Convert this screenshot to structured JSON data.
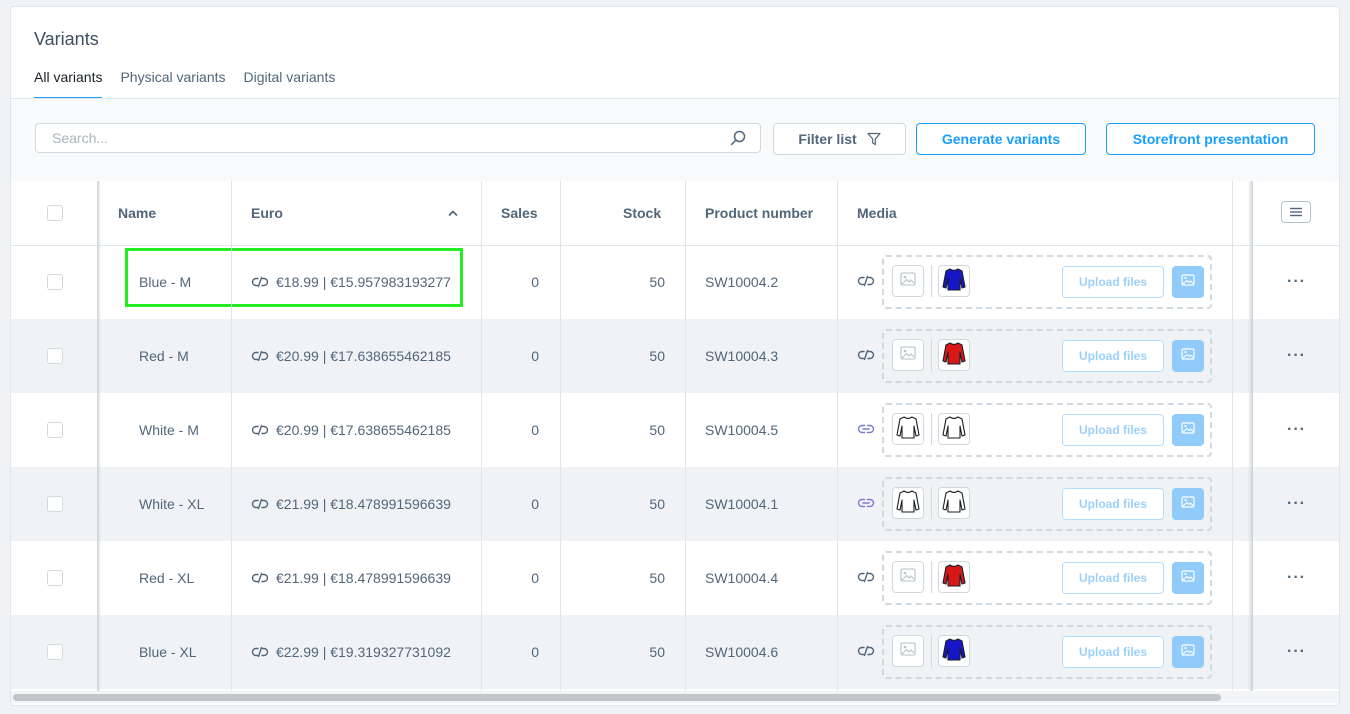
{
  "card": {
    "title": "Variants",
    "tabs": [
      {
        "label": "All variants",
        "active": true
      },
      {
        "label": "Physical variants",
        "active": false
      },
      {
        "label": "Digital variants",
        "active": false
      }
    ]
  },
  "toolbar": {
    "search_placeholder": "Search...",
    "filter_label": "Filter list",
    "generate_label": "Generate variants",
    "storefront_label": "Storefront presentation"
  },
  "table": {
    "columns": {
      "name": "Name",
      "euro": "Euro",
      "sales": "Sales",
      "stock": "Stock",
      "product_number": "Product number",
      "media": "Media"
    },
    "sort": {
      "column": "Euro",
      "direction": "ascending"
    },
    "upload_label": "Upload files",
    "rows": [
      {
        "name": "Blue - M",
        "price": "€18.99 | €15.957983193277",
        "sales": "0",
        "stock": "50",
        "product_number": "SW10004.2",
        "media_inherited": false,
        "images": [
          "placeholder-image",
          "blue-sweater"
        ],
        "highlighted": true
      },
      {
        "name": "Red - M",
        "price": "€20.99 | €17.638655462185",
        "sales": "0",
        "stock": "50",
        "product_number": "SW10004.3",
        "media_inherited": false,
        "images": [
          "placeholder-image",
          "red-sweater"
        ],
        "highlighted": false
      },
      {
        "name": "White - M",
        "price": "€20.99 | €17.638655462185",
        "sales": "0",
        "stock": "50",
        "product_number": "SW10004.5",
        "media_inherited": true,
        "images": [
          "white-sweater",
          "white-sweater"
        ],
        "highlighted": false
      },
      {
        "name": "White - XL",
        "price": "€21.99 | €18.478991596639",
        "sales": "0",
        "stock": "50",
        "product_number": "SW10004.1",
        "media_inherited": true,
        "images": [
          "white-sweater",
          "white-sweater"
        ],
        "highlighted": false
      },
      {
        "name": "Red - XL",
        "price": "€21.99 | €18.478991596639",
        "sales": "0",
        "stock": "50",
        "product_number": "SW10004.4",
        "media_inherited": false,
        "images": [
          "placeholder-image",
          "red-sweater"
        ],
        "highlighted": false
      },
      {
        "name": "Blue - XL",
        "price": "€22.99 | €19.319327731092",
        "sales": "0",
        "stock": "50",
        "product_number": "SW10004.6",
        "media_inherited": false,
        "images": [
          "placeholder-image",
          "blue-sweater"
        ],
        "highlighted": false
      }
    ]
  },
  "colors": {
    "accent": "#189eff",
    "highlight": "#22ee22",
    "link_active": "#7b7bd6",
    "link_inactive": "#52667a",
    "sweater_blue": "#1616c8",
    "sweater_red": "#d81818"
  }
}
